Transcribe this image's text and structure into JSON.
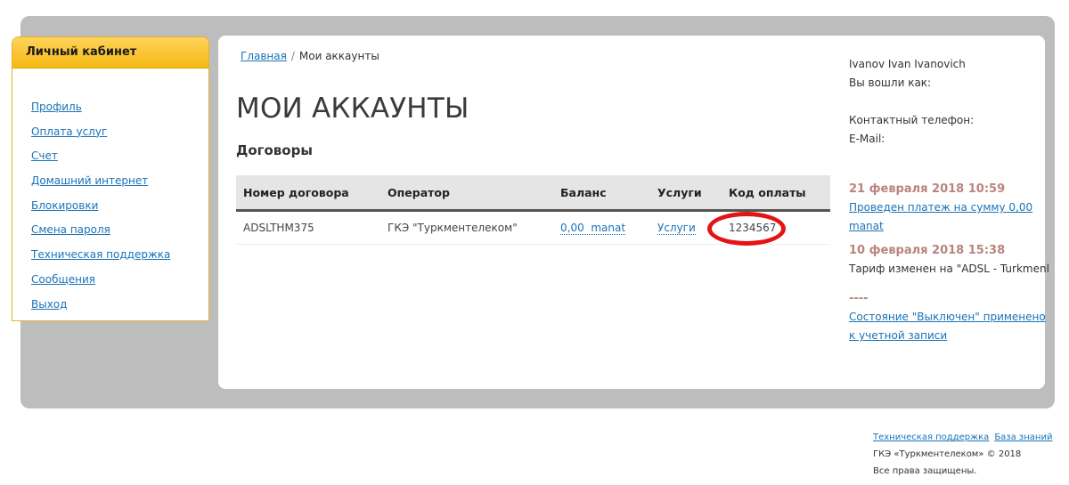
{
  "sidebar": {
    "title": "Личный кабинет",
    "items": [
      {
        "label": "Профиль"
      },
      {
        "label": "Оплата услуг"
      },
      {
        "label": "Счет"
      },
      {
        "label": "Домашний интернет"
      },
      {
        "label": "Блокировки"
      },
      {
        "label": "Смена пароля"
      },
      {
        "label": "Техническая поддержка"
      },
      {
        "label": "Сообщения"
      },
      {
        "label": "Выход"
      }
    ]
  },
  "breadcrumb": {
    "home": "Главная",
    "separator": "/",
    "current": "Мои аккаунты"
  },
  "main": {
    "title": "МОИ АККАУНТЫ",
    "section_title": "Договоры",
    "table": {
      "headers": [
        "Номер договора",
        "Оператор",
        "Баланс",
        "Услуги",
        "Код оплаты"
      ],
      "rows": [
        {
          "contract": "ADSLTHM375",
          "operator": "ГКЭ \"Туркментелеком\"",
          "balance": "0,00  manat",
          "services": "Услуги",
          "payment_code": "1234567"
        }
      ]
    }
  },
  "user": {
    "name": "Ivanov Ivan Ivanovich",
    "logged_in_as": "Вы вошли как:",
    "phone_label": "Контактный телефон:",
    "email_label": "E-Mail:"
  },
  "events": [
    {
      "date": "21 февраля 2018 10:59",
      "text": "Проведен платеж на сумму 0,00 manat"
    },
    {
      "date": "10 февраля 2018 15:38",
      "text": "Тариф изменен на \"ADSL - Turkmenl"
    },
    {
      "date": "----",
      "text": "Состояние \"Выключен\" применено к учетной записи "
    }
  ],
  "footer": {
    "support": "Техническая поддержка",
    "knowledge_base": "База знаний",
    "copyright": "ГКЭ «Туркментелеком» © 2018",
    "rights": "Все права защищены."
  },
  "colors": {
    "accent": "#f5b913",
    "link": "#1a73b8",
    "highlight": "#e41414",
    "event_date": "#b8857e"
  }
}
